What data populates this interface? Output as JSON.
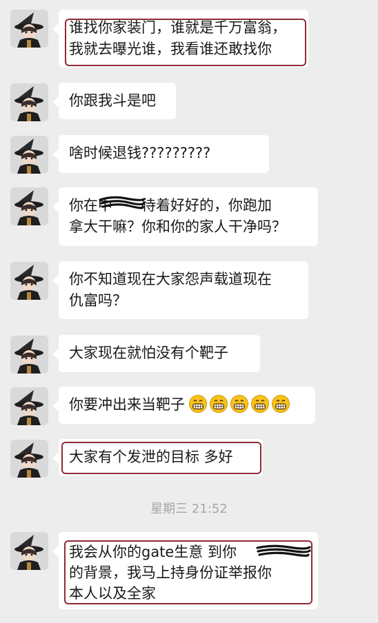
{
  "chat": {
    "messages": [
      {
        "line1": "谁找你家装门，谁就是千万富翁，",
        "line2": "我就去曝光谁，我看谁还敢找你"
      },
      {
        "line1": "你跟我斗是吧"
      },
      {
        "line1": "啥时候退钱?????????"
      },
      {
        "line1_a": "你在中",
        "line1_b": "待着好好的，你跑加",
        "line2": "拿大干嘛？你和你的家人干净吗？"
      },
      {
        "line1": "你不知道现在大家怨声载道现在",
        "line2": "仇富吗？"
      },
      {
        "line1": "大家现在就怕没有个靶子"
      },
      {
        "line1": "你要冲出来当靶子",
        "emoji": "grinning-emoji",
        "emoji_count": 5
      },
      {
        "line1": "大家有个发泄的目标 多好"
      },
      {
        "line1": "我会从你的gate生意 到你",
        "line2": "的背景，我马上持身份证举报你",
        "line3": "本人以及全家"
      }
    ],
    "timestamp": "星期三 21:52",
    "colors": {
      "background": "#ededed",
      "bubble": "#ffffff",
      "highlight_box": "#8e2a35",
      "timestamp": "#a6a6a6"
    }
  }
}
